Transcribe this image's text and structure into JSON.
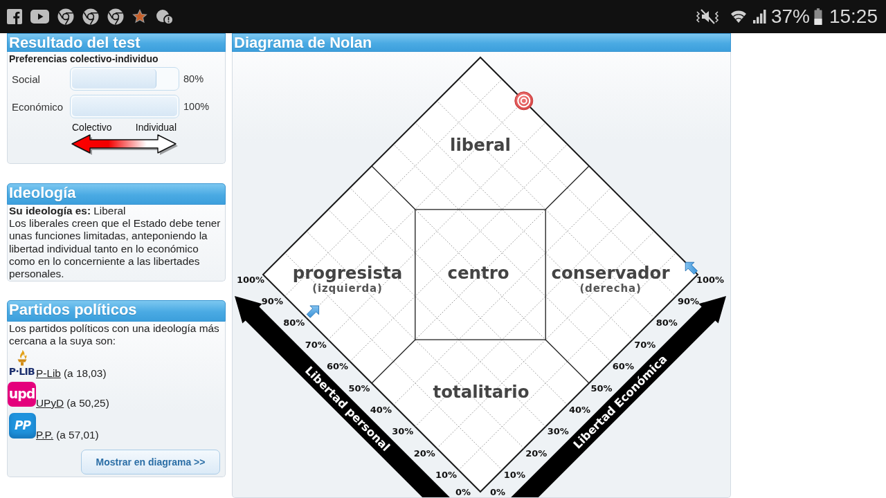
{
  "status_bar": {
    "battery": "37%",
    "time": "15:25"
  },
  "result_panel": {
    "title": "Resultado del test",
    "subtitle": "Preferencias colectivo-individuo",
    "bars": [
      {
        "label": "Social",
        "level": 0.8,
        "reading": "80%"
      },
      {
        "label": "Económico",
        "level": 1,
        "reading": "100%"
      }
    ],
    "scale": {
      "left": "Colectivo",
      "right": "Individual"
    }
  },
  "ideology_panel": {
    "title": "Ideología",
    "result": "**Su ideología es:** Liberal",
    "description": "Los liberales creen que el Estado debe tener unas funciones limitadas, anteponiendo la libertad individual tanto en lo económico como en lo concerniente a las libertades personales."
  },
  "parties_panel": {
    "title": "Partidos políticos",
    "intro": "Los partidos políticos con una ideología más cercana a la suya son:",
    "parties": [
      {
        "kind": "emblem",
        "logo": "P·LIB",
        "color": "#1c2f6e",
        "name": "P-Lib",
        "score": "(a 18,03)"
      },
      {
        "kind": "tile",
        "logo": "upd",
        "color": "#e4007c",
        "name": "UPyD",
        "score": "(a 50,25)"
      },
      {
        "kind": "glossy",
        "logo": "PP",
        "color": "#1f93dd",
        "name": "P.P.",
        "score": "(a 57,01)"
      }
    ],
    "button": "Mostrar en diagrama >>"
  },
  "diagram_panel": {
    "title": "Diagrama de Nolan",
    "regions": [
      {
        "label": "liberal"
      },
      {
        "label": "progresista",
        "sublabel": "(izquierda)"
      },
      {
        "label": "centro"
      },
      {
        "label": "conservador",
        "sublabel": "(derecha)"
      },
      {
        "label": "totalitario"
      }
    ],
    "personal_axis": {
      "label": "Libertad personal",
      "ticks": [
        "0%",
        "10%",
        "20%",
        "30%",
        "40%",
        "50%",
        "60%",
        "70%",
        "80%",
        "90%",
        "100%"
      ]
    },
    "economic_axis": {
      "label": "Libertad Económica",
      "ticks": [
        "0%",
        "10%",
        "20%",
        "30%",
        "40%",
        "50%",
        "60%",
        "70%",
        "80%",
        "90%",
        "100%"
      ]
    }
  }
}
